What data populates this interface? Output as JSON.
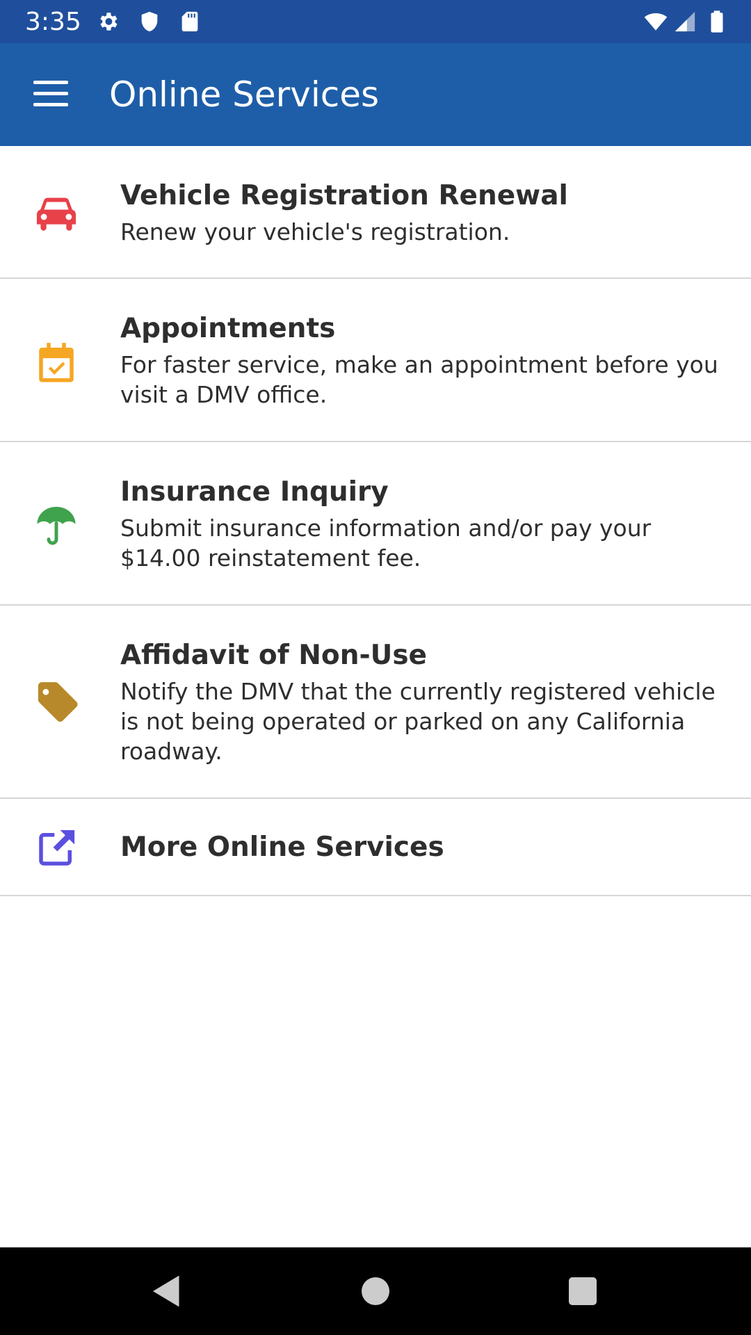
{
  "status_bar": {
    "time": "3:35",
    "left_icons": [
      "gear-icon",
      "shield-icon",
      "sd-card-icon"
    ],
    "right_icons": [
      "wifi-icon",
      "signal-icon",
      "battery-icon"
    ]
  },
  "app_bar": {
    "title": "Online Services",
    "menu_icon": "hamburger-menu-icon"
  },
  "services": [
    {
      "title": "Vehicle Registration Renewal",
      "description": "Renew your vehicle's registration.",
      "icon": "car-icon",
      "icon_color": "#e8414a"
    },
    {
      "title": "Appointments",
      "description": "For faster service, make an appointment before you visit a DMV office.",
      "icon": "calendar-check-icon",
      "icon_color": "#f5a623"
    },
    {
      "title": "Insurance Inquiry",
      "description": "Submit insurance information and/or pay your $14.00 reinstatement fee.",
      "icon": "umbrella-icon",
      "icon_color": "#3fa34d"
    },
    {
      "title": "Affidavit of Non-Use",
      "description": "Notify the DMV that the currently registered vehicle is not being operated or parked on any California roadway.",
      "icon": "tag-icon",
      "icon_color": "#b8892a"
    },
    {
      "title": "More Online Services",
      "description": "",
      "icon": "external-link-icon",
      "icon_color": "#5b4fe0"
    }
  ],
  "colors": {
    "status_bar": "#1f4f9c",
    "app_bar": "#1e5ea8",
    "divider": "#d6d6d6",
    "nav_bar": "#000000"
  },
  "nav_bar": {
    "buttons": [
      "back-icon",
      "home-icon",
      "recents-icon"
    ]
  }
}
